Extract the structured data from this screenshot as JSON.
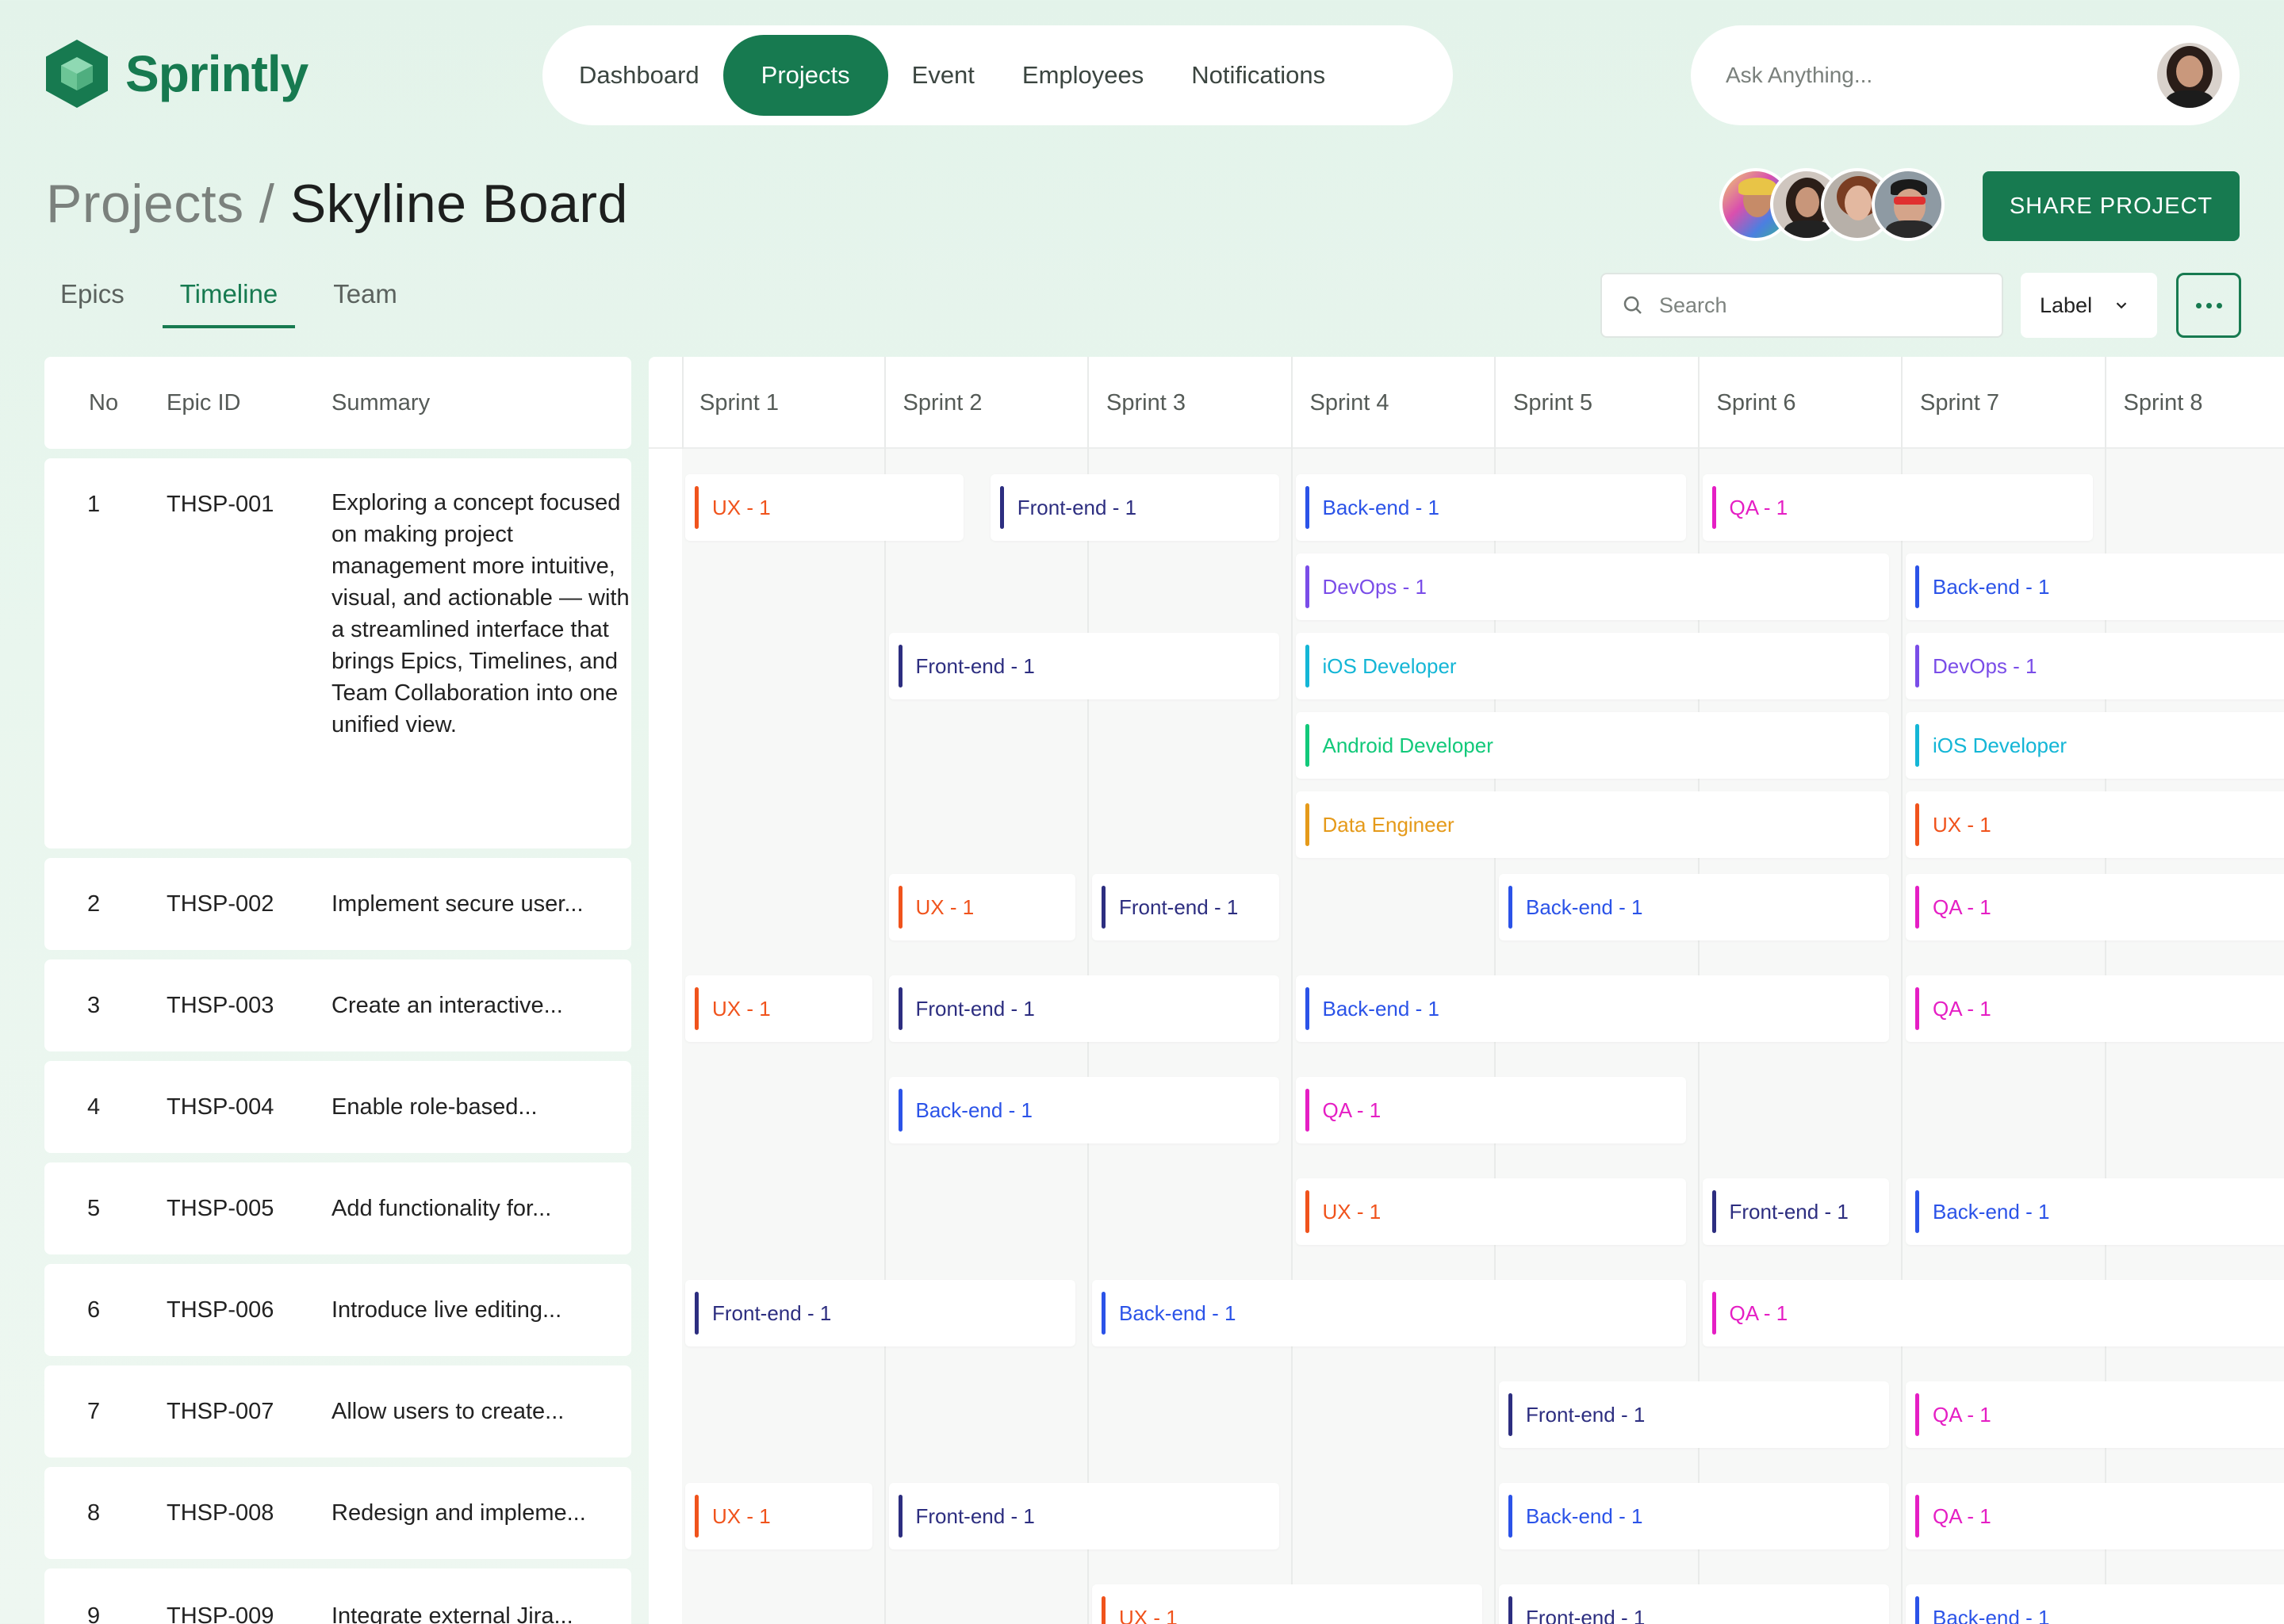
{
  "app": {
    "name": "Sprintly"
  },
  "colors": {
    "brand": "#177a50",
    "ux": "#f0531c",
    "frontend": "#2d2e80",
    "backend": "#2b53e8",
    "qa": "#e51ec4",
    "devops": "#7a4de8",
    "ios": "#14b6d6",
    "android": "#12c97a",
    "data": "#e59a1a"
  },
  "nav": {
    "items": [
      "Dashboard",
      "Projects",
      "Event",
      "Employees",
      "Notifications"
    ],
    "active": "Projects"
  },
  "ask": {
    "placeholder": "Ask Anything..."
  },
  "breadcrumb": {
    "parent": "Projects",
    "separator": " / ",
    "current": "Skyline Board"
  },
  "share_label": "SHARE PROJECT",
  "tabs": [
    "Epics",
    "Timeline",
    "Team"
  ],
  "active_tab": "Timeline",
  "search": {
    "placeholder": "Search"
  },
  "label_filter": {
    "value": "Label"
  },
  "table": {
    "headers": [
      "No",
      "Epic ID",
      "Summary"
    ],
    "rows": [
      {
        "no": "1",
        "id": "THSP-001",
        "summary": "Exploring a concept focused on making project management more intuitive, visual, and actionable — with a streamlined interface that brings Epics, Timelines, and Team Collaboration into one unified view."
      },
      {
        "no": "2",
        "id": "THSP-002",
        "summary": "Implement secure user..."
      },
      {
        "no": "3",
        "id": "THSP-003",
        "summary": "Create an interactive..."
      },
      {
        "no": "4",
        "id": "THSP-004",
        "summary": "Enable role-based..."
      },
      {
        "no": "5",
        "id": "THSP-005",
        "summary": "Add functionality for..."
      },
      {
        "no": "6",
        "id": "THSP-006",
        "summary": "Introduce live editing..."
      },
      {
        "no": "7",
        "id": "THSP-007",
        "summary": "Allow users to create..."
      },
      {
        "no": "8",
        "id": "THSP-008",
        "summary": "Redesign and impleme..."
      },
      {
        "no": "9",
        "id": "THSP-009",
        "summary": "Integrate external Jira..."
      }
    ]
  },
  "sprints": [
    "Sprint 1",
    "Sprint 2",
    "Sprint 3",
    "Sprint 4",
    "Sprint 5",
    "Sprint 6",
    "Sprint 7",
    "Sprint 8"
  ],
  "tasks": [
    {
      "label": "UX - 1",
      "kind": "ux",
      "lane": 0,
      "start": 1,
      "end": 2.4
    },
    {
      "label": "Front-end - 1",
      "kind": "frontend",
      "lane": 0,
      "start": 2.5,
      "end": 3.95
    },
    {
      "label": "Back-end - 1",
      "kind": "backend",
      "lane": 0,
      "start": 4,
      "end": 5.95
    },
    {
      "label": "QA - 1",
      "kind": "qa",
      "lane": 0,
      "start": 6,
      "end": 7.95
    },
    {
      "label": "DevOps - 1",
      "kind": "devops",
      "lane": 1,
      "start": 4,
      "end": 6.95
    },
    {
      "label": "Back-end - 1",
      "kind": "backend",
      "lane": 1,
      "start": 7,
      "end": 9
    },
    {
      "label": "Front-end - 1",
      "kind": "frontend",
      "lane": 2,
      "start": 2,
      "end": 3.95
    },
    {
      "label": "iOS Developer",
      "kind": "ios",
      "lane": 2,
      "start": 4,
      "end": 6.95
    },
    {
      "label": "DevOps - 1",
      "kind": "devops",
      "lane": 2,
      "start": 7,
      "end": 9
    },
    {
      "label": "Android Developer",
      "kind": "android",
      "lane": 3,
      "start": 4,
      "end": 6.95
    },
    {
      "label": "iOS Developer",
      "kind": "ios",
      "lane": 3,
      "start": 7,
      "end": 9
    },
    {
      "label": "Data Engineer",
      "kind": "data",
      "lane": 4,
      "start": 4,
      "end": 6.95
    },
    {
      "label": "UX - 1",
      "kind": "ux",
      "lane": 4,
      "start": 7,
      "end": 9
    },
    {
      "label": "UX - 1",
      "kind": "ux",
      "lane": 5,
      "start": 2,
      "end": 2.95
    },
    {
      "label": "Front-end - 1",
      "kind": "frontend",
      "lane": 5,
      "start": 3,
      "end": 3.95
    },
    {
      "label": "Back-end - 1",
      "kind": "backend",
      "lane": 5,
      "start": 5,
      "end": 6.95
    },
    {
      "label": "QA - 1",
      "kind": "qa",
      "lane": 5,
      "start": 7,
      "end": 9
    },
    {
      "label": "UX - 1",
      "kind": "ux",
      "lane": 6,
      "start": 1,
      "end": 1.95
    },
    {
      "label": "Front-end - 1",
      "kind": "frontend",
      "lane": 6,
      "start": 2,
      "end": 3.95
    },
    {
      "label": "Back-end - 1",
      "kind": "backend",
      "lane": 6,
      "start": 4,
      "end": 6.95
    },
    {
      "label": "QA - 1",
      "kind": "qa",
      "lane": 6,
      "start": 7,
      "end": 9
    },
    {
      "label": "Back-end - 1",
      "kind": "backend",
      "lane": 7,
      "start": 2,
      "end": 3.95
    },
    {
      "label": "QA - 1",
      "kind": "qa",
      "lane": 7,
      "start": 4,
      "end": 5.95
    },
    {
      "label": "UX - 1",
      "kind": "ux",
      "lane": 8,
      "start": 4,
      "end": 5.95
    },
    {
      "label": "Front-end - 1",
      "kind": "frontend",
      "lane": 8,
      "start": 6,
      "end": 6.95
    },
    {
      "label": "Back-end - 1",
      "kind": "backend",
      "lane": 8,
      "start": 7,
      "end": 9
    },
    {
      "label": "Front-end - 1",
      "kind": "frontend",
      "lane": 9,
      "start": 1,
      "end": 2.95
    },
    {
      "label": "Back-end - 1",
      "kind": "backend",
      "lane": 9,
      "start": 3,
      "end": 5.95
    },
    {
      "label": "QA - 1",
      "kind": "qa",
      "lane": 9,
      "start": 6,
      "end": 9
    },
    {
      "label": "Front-end - 1",
      "kind": "frontend",
      "lane": 10,
      "start": 5,
      "end": 6.95
    },
    {
      "label": "QA - 1",
      "kind": "qa",
      "lane": 10,
      "start": 7,
      "end": 9
    },
    {
      "label": "UX - 1",
      "kind": "ux",
      "lane": 11,
      "start": 1,
      "end": 1.95
    },
    {
      "label": "Front-end - 1",
      "kind": "frontend",
      "lane": 11,
      "start": 2,
      "end": 3.95
    },
    {
      "label": "Back-end - 1",
      "kind": "backend",
      "lane": 11,
      "start": 5,
      "end": 6.95
    },
    {
      "label": "QA - 1",
      "kind": "qa",
      "lane": 11,
      "start": 7,
      "end": 9
    },
    {
      "label": "UX - 1",
      "kind": "ux",
      "lane": 12,
      "start": 3,
      "end": 4.95
    },
    {
      "label": "Front-end - 1",
      "kind": "frontend",
      "lane": 12,
      "start": 5,
      "end": 6.95
    },
    {
      "label": "Back-end - 1",
      "kind": "backend",
      "lane": 12,
      "start": 7,
      "end": 9
    }
  ]
}
